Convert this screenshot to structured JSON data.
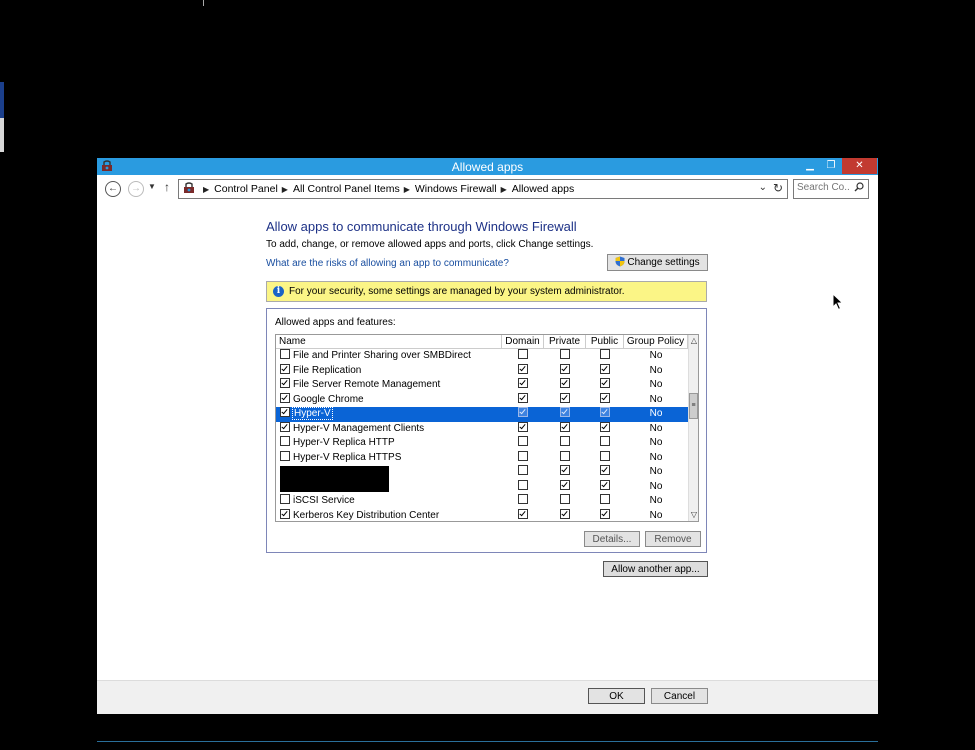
{
  "window": {
    "title": "Allowed apps",
    "controls": {
      "minimize": "▁",
      "maximize": "❐",
      "close": "✕"
    }
  },
  "address_bar": {
    "breadcrumbs": [
      "Control Panel",
      "All Control Panel Items",
      "Windows Firewall",
      "Allowed apps"
    ],
    "search_placeholder": "Search Co..."
  },
  "content": {
    "heading": "Allow apps to communicate through Windows Firewall",
    "subtext": "To add, change, or remove allowed apps and ports, click Change settings.",
    "risk_link": "What are the risks of allowing an app to communicate?",
    "change_settings": "Change settings",
    "info_message": "For your security, some settings are managed by your system administrator.",
    "group_label": "Allowed apps and features:",
    "columns": {
      "name": "Name",
      "domain": "Domain",
      "private": "Private",
      "public": "Public",
      "group_policy": "Group Policy"
    },
    "rows": [
      {
        "name": "File and Printer Sharing over SMBDirect",
        "enabled": false,
        "domain": false,
        "private": false,
        "public": false,
        "gp": "No"
      },
      {
        "name": "File Replication",
        "enabled": true,
        "domain": true,
        "private": true,
        "public": true,
        "gp": "No"
      },
      {
        "name": "File Server Remote Management",
        "enabled": true,
        "domain": true,
        "private": true,
        "public": true,
        "gp": "No"
      },
      {
        "name": "Google Chrome",
        "enabled": true,
        "domain": true,
        "private": true,
        "public": true,
        "gp": "No"
      },
      {
        "name": "Hyper-V",
        "enabled": true,
        "domain": true,
        "private": true,
        "public": true,
        "gp": "No",
        "selected": true
      },
      {
        "name": "Hyper-V Management Clients",
        "enabled": true,
        "domain": true,
        "private": true,
        "public": true,
        "gp": "No"
      },
      {
        "name": "Hyper-V Replica HTTP",
        "enabled": false,
        "domain": false,
        "private": false,
        "public": false,
        "gp": "No"
      },
      {
        "name": "Hyper-V Replica HTTPS",
        "enabled": false,
        "domain": false,
        "private": false,
        "public": false,
        "gp": "No"
      },
      {
        "name": "",
        "enabled": null,
        "domain": false,
        "private": true,
        "public": true,
        "gp": "No",
        "redacted": true
      },
      {
        "name": "",
        "enabled": null,
        "domain": false,
        "private": true,
        "public": true,
        "gp": "No",
        "redacted": true
      },
      {
        "name": "iSCSI Service",
        "enabled": false,
        "domain": false,
        "private": false,
        "public": false,
        "gp": "No"
      },
      {
        "name": "Kerberos Key Distribution Center",
        "enabled": true,
        "domain": true,
        "private": true,
        "public": true,
        "gp": "No"
      }
    ],
    "details_button": "Details...",
    "remove_button": "Remove",
    "allow_another_button": "Allow another app..."
  },
  "footer": {
    "ok": "OK",
    "cancel": "Cancel"
  }
}
